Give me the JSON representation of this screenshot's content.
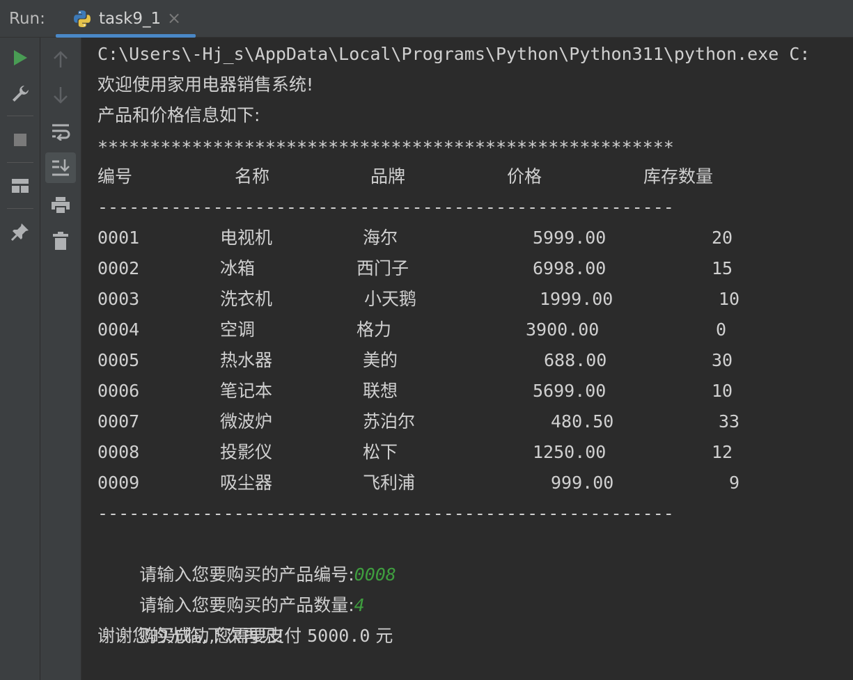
{
  "header": {
    "run_label": "Run:",
    "tab_title": "task9_1",
    "tab_close": "×"
  },
  "toolbar": {
    "outer": [
      "run-icon",
      "wrench-icon",
      "stop-icon",
      "layout-icon",
      "pin-icon"
    ],
    "inner": [
      "arrow-up-icon",
      "arrow-down-icon",
      "soft-wrap-icon",
      "scroll-to-end-icon",
      "print-icon",
      "trash-icon"
    ]
  },
  "colors": {
    "accent": "#4a88c7",
    "run_green": "#499c54",
    "input_green": "#3f9e3f",
    "text": "#d0d0d0"
  },
  "console": {
    "command": "C:\\Users\\-Hj_s\\AppData\\Local\\Programs\\Python\\Python311\\python.exe C:",
    "welcome": "欢迎使用家用电器销售系统!",
    "info": "产品和价格信息如下:",
    "stars": "*******************************************************",
    "headers": [
      "编号",
      "名称",
      "品牌",
      "价格",
      "库存数量"
    ],
    "dashes": "-------------------------------------------------------",
    "rows": [
      [
        "0001",
        "电视机",
        "海尔",
        "5999.00",
        "20"
      ],
      [
        "0002",
        "冰箱",
        "西门子",
        "6998.00",
        "15"
      ],
      [
        "0003",
        "洗衣机",
        "小天鹅",
        "1999.00",
        "10"
      ],
      [
        "0004",
        "空调",
        "格力",
        "3900.00",
        "0"
      ],
      [
        "0005",
        "热水器",
        "美的",
        "688.00",
        "30"
      ],
      [
        "0006",
        "笔记本",
        "联想",
        "5699.00",
        "10"
      ],
      [
        "0007",
        "微波炉",
        "苏泊尔",
        "480.50",
        "33"
      ],
      [
        "0008",
        "投影仪",
        "松下",
        "1250.00",
        "12"
      ],
      [
        "0009",
        "吸尘器",
        "飞利浦",
        "999.00",
        "9"
      ]
    ],
    "prompt_code": "请输入您要购买的产品编号:",
    "input_code": "0008",
    "prompt_qty": "请输入您要购买的产品数量:",
    "input_qty": "4",
    "result_prefix": "购买成功,您需要支付 ",
    "result_amount": "5000.0",
    "result_suffix": " 元",
    "goodbye": "谢谢您的光临,下次再见!"
  }
}
